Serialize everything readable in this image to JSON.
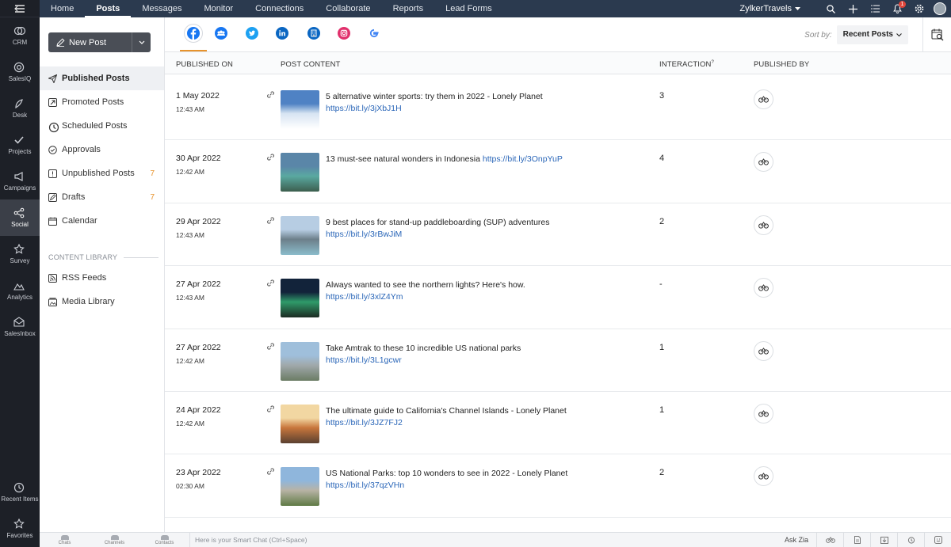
{
  "rail": {
    "items": [
      {
        "label": "CRM",
        "icon": "crm-icon"
      },
      {
        "label": "SalesIQ",
        "icon": "salesiq-icon"
      },
      {
        "label": "Desk",
        "icon": "desk-icon"
      },
      {
        "label": "Projects",
        "icon": "projects-icon"
      },
      {
        "label": "Campaigns",
        "icon": "campaigns-icon"
      },
      {
        "label": "Social",
        "icon": "social-icon",
        "active": true
      },
      {
        "label": "Survey",
        "icon": "survey-icon"
      },
      {
        "label": "Analytics",
        "icon": "analytics-icon"
      },
      {
        "label": "SalesInbox",
        "icon": "salesinbox-icon"
      }
    ],
    "bottom": [
      {
        "label": "Recent Items",
        "icon": "clock-icon"
      },
      {
        "label": "Favorites",
        "icon": "star-icon"
      }
    ]
  },
  "topnav": {
    "tabs": [
      "Home",
      "Posts",
      "Messages",
      "Monitor",
      "Connections",
      "Collaborate",
      "Reports",
      "Lead Forms"
    ],
    "active_tab": "Posts",
    "brand": "ZylkerTravels",
    "notification_count": "1"
  },
  "sidebar": {
    "new_post": "New Post",
    "items": [
      {
        "label": "Published Posts",
        "icon": "paper-plane-icon",
        "active": true,
        "count": ""
      },
      {
        "label": "Promoted Posts",
        "icon": "promote-icon",
        "count": ""
      },
      {
        "label": "Scheduled Posts",
        "icon": "clock-icon",
        "count": ""
      },
      {
        "label": "Approvals",
        "icon": "check-circle-icon",
        "count": ""
      },
      {
        "label": "Unpublished Posts",
        "icon": "warning-icon",
        "count": "7"
      },
      {
        "label": "Drafts",
        "icon": "draft-icon",
        "count": "7"
      },
      {
        "label": "Calendar",
        "icon": "calendar-icon",
        "count": ""
      }
    ],
    "library_title": "CONTENT LIBRARY",
    "library_items": [
      {
        "label": "RSS Feeds",
        "icon": "rss-icon"
      },
      {
        "label": "Media Library",
        "icon": "media-icon"
      }
    ]
  },
  "networks": [
    {
      "name": "facebook-icon",
      "color": "#1877f2",
      "active": true
    },
    {
      "name": "facebook-group-icon",
      "color": "#1877f2"
    },
    {
      "name": "twitter-icon",
      "color": "#1da1f2"
    },
    {
      "name": "linkedin-icon",
      "color": "#0a66c2"
    },
    {
      "name": "linkedin-page-icon",
      "color": "#0a66c2"
    },
    {
      "name": "instagram-icon",
      "color": "#e1306c"
    },
    {
      "name": "google-icon",
      "color": "#4285f4"
    }
  ],
  "sort": {
    "label": "Sort by:",
    "value": "Recent Posts"
  },
  "table": {
    "headers": {
      "published_on": "PUBLISHED ON",
      "post_content": "POST CONTENT",
      "interaction": "INTERACTION",
      "interaction_sup": "?",
      "published_by": "PUBLISHED BY"
    },
    "rows": [
      {
        "date": "1 May 2022",
        "time": "12:43 AM",
        "text": "5 alternative winter sports: try them in 2022 - Lonely Planet",
        "link": "https://bit.ly/3jXbJ1H",
        "inline": false,
        "interaction": "3",
        "thumb": [
          "#4f82c4",
          "#d7e4f2",
          "#ffffff"
        ]
      },
      {
        "date": "30 Apr 2022",
        "time": "12:42 AM",
        "text": "13 must-see natural wonders in Indonesia",
        "link": "https://bit.ly/3OnpYuP",
        "inline": true,
        "interaction": "4",
        "thumb": [
          "#5a86a8",
          "#5aa9a1",
          "#3c5e4e"
        ]
      },
      {
        "date": "29 Apr 2022",
        "time": "12:43 AM",
        "text": "9 best places for stand-up paddleboarding (SUP) adventures",
        "link": "https://bit.ly/3rBwJiM",
        "inline": false,
        "interaction": "2",
        "thumb": [
          "#b7cde3",
          "#6c7f8a",
          "#8bbccb"
        ]
      },
      {
        "date": "27 Apr 2022",
        "time": "12:43 AM",
        "text": "Always wanted to see the northern lights? Here's how.",
        "link": "https://bit.ly/3xlZ4Ym",
        "inline": false,
        "interaction": "-",
        "thumb": [
          "#12233a",
          "#2f9b6a",
          "#1c2b22"
        ]
      },
      {
        "date": "27 Apr 2022",
        "time": "12:42 AM",
        "text": "Take Amtrak to these 10 incredible US national parks",
        "link": "https://bit.ly/3L1gcwr",
        "inline": false,
        "interaction": "1",
        "thumb": [
          "#9fbfdb",
          "#a0a8ab",
          "#6b7c64"
        ]
      },
      {
        "date": "24 Apr 2022",
        "time": "12:42 AM",
        "text": "The ultimate guide to California's Channel Islands - Lonely Planet",
        "link": "https://bit.ly/3JZ7FJ2",
        "inline": false,
        "interaction": "1",
        "thumb": [
          "#f2d7a2",
          "#c8763c",
          "#5a4030"
        ]
      },
      {
        "date": "23 Apr 2022",
        "time": "02:30 AM",
        "text": "US National Parks: top 10 wonders to see in 2022 - Lonely Planet",
        "link": "https://bit.ly/37qzVHn",
        "inline": false,
        "interaction": "2",
        "thumb": [
          "#8fb6dc",
          "#b8b3a5",
          "#5f7a45"
        ]
      }
    ]
  },
  "bottombar": {
    "items": [
      "Chats",
      "Channels",
      "Contacts"
    ],
    "smart_chat": "Here is your Smart Chat (Ctrl+Space)",
    "ask_zia": "Ask Zia"
  }
}
